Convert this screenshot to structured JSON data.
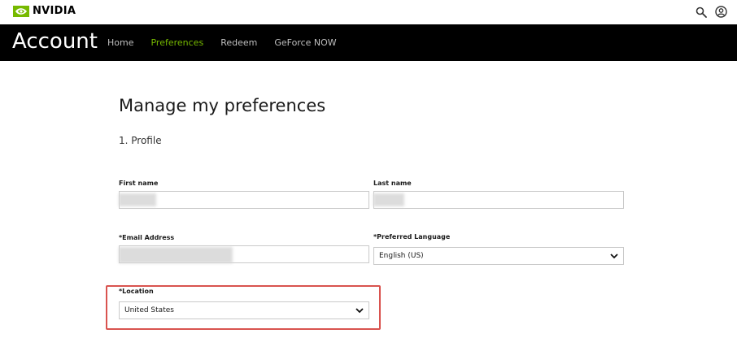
{
  "brand": {
    "name": "NVIDIA",
    "accent": "#76b900"
  },
  "header": {
    "icons": [
      "search-icon",
      "user-circle-icon"
    ]
  },
  "account": {
    "title": "Account",
    "nav": [
      {
        "label": "Home",
        "active": false
      },
      {
        "label": "Preferences",
        "active": true
      },
      {
        "label": "Redeem",
        "active": false
      },
      {
        "label": "GeForce NOW",
        "active": false
      }
    ]
  },
  "main": {
    "title": "Manage my preferences",
    "section": "1. Profile",
    "form": {
      "first_name": {
        "label": "First name",
        "value": ""
      },
      "last_name": {
        "label": "Last name",
        "value": ""
      },
      "email": {
        "label": "*Email Address",
        "value": ""
      },
      "language": {
        "label": "*Preferred Language",
        "value": "English (US)"
      },
      "location": {
        "label": "*Location",
        "value": "United States"
      }
    }
  },
  "colors": {
    "highlight": "#d9534f",
    "header_bg": "#000000",
    "nav_inactive": "#bfbfbf"
  }
}
